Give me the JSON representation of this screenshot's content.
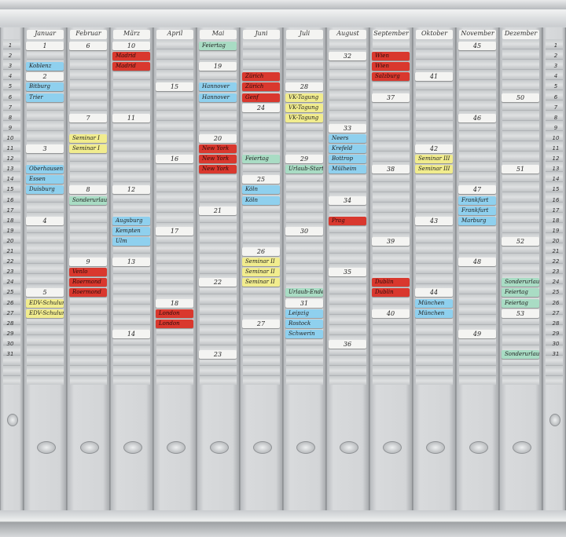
{
  "palette": {
    "white": "#f4f4f2",
    "blue": "#8fd0ee",
    "red": "#d9382e",
    "yellow": "#f1ec8e",
    "green": "#a9dcc4"
  },
  "months": [
    "Januar",
    "Februar",
    "März",
    "April",
    "Mai",
    "Juni",
    "Juli",
    "August",
    "September",
    "Oktober",
    "November",
    "Dezember"
  ],
  "days": [
    "1",
    "2",
    "3",
    "4",
    "5",
    "6",
    "7",
    "8",
    "9",
    "10",
    "11",
    "12",
    "13",
    "14",
    "15",
    "16",
    "17",
    "18",
    "19",
    "20",
    "21",
    "22",
    "23",
    "24",
    "25",
    "26",
    "27",
    "28",
    "29",
    "30",
    "31"
  ],
  "cards": [
    {
      "m": 0,
      "d": 1,
      "t": "1",
      "c": "white"
    },
    {
      "m": 0,
      "d": 3,
      "t": "Koblenz",
      "c": "blue"
    },
    {
      "m": 0,
      "d": 4,
      "t": "2",
      "c": "white"
    },
    {
      "m": 0,
      "d": 5,
      "t": "Bitburg",
      "c": "blue"
    },
    {
      "m": 0,
      "d": 6,
      "t": "Trier",
      "c": "blue"
    },
    {
      "m": 0,
      "d": 11,
      "t": "3",
      "c": "white"
    },
    {
      "m": 0,
      "d": 13,
      "t": "Oberhausen",
      "c": "blue"
    },
    {
      "m": 0,
      "d": 14,
      "t": "Essen",
      "c": "blue"
    },
    {
      "m": 0,
      "d": 15,
      "t": "Duisburg",
      "c": "blue"
    },
    {
      "m": 0,
      "d": 18,
      "t": "4",
      "c": "white"
    },
    {
      "m": 0,
      "d": 25,
      "t": "5",
      "c": "white"
    },
    {
      "m": 0,
      "d": 26,
      "t": "EDV-Schulung",
      "c": "yellow"
    },
    {
      "m": 0,
      "d": 27,
      "t": "EDV-Schulung",
      "c": "yellow"
    },
    {
      "m": 1,
      "d": 1,
      "t": "6",
      "c": "white"
    },
    {
      "m": 1,
      "d": 8,
      "t": "7",
      "c": "white"
    },
    {
      "m": 1,
      "d": 10,
      "t": "Seminar I",
      "c": "yellow"
    },
    {
      "m": 1,
      "d": 11,
      "t": "Seminar I",
      "c": "yellow"
    },
    {
      "m": 1,
      "d": 15,
      "t": "8",
      "c": "white"
    },
    {
      "m": 1,
      "d": 16,
      "t": "Sonderurlaub",
      "c": "green"
    },
    {
      "m": 1,
      "d": 22,
      "t": "9",
      "c": "white"
    },
    {
      "m": 1,
      "d": 23,
      "t": "Venlo",
      "c": "red"
    },
    {
      "m": 1,
      "d": 24,
      "t": "Roermond",
      "c": "red"
    },
    {
      "m": 1,
      "d": 25,
      "t": "Roermond",
      "c": "red"
    },
    {
      "m": 2,
      "d": 1,
      "t": "10",
      "c": "white"
    },
    {
      "m": 2,
      "d": 2,
      "t": "Madrid",
      "c": "red"
    },
    {
      "m": 2,
      "d": 3,
      "t": "Madrid",
      "c": "red"
    },
    {
      "m": 2,
      "d": 8,
      "t": "11",
      "c": "white"
    },
    {
      "m": 2,
      "d": 15,
      "t": "12",
      "c": "white"
    },
    {
      "m": 2,
      "d": 18,
      "t": "Augsburg",
      "c": "blue"
    },
    {
      "m": 2,
      "d": 19,
      "t": "Kempten",
      "c": "blue"
    },
    {
      "m": 2,
      "d": 20,
      "t": "Ulm",
      "c": "blue"
    },
    {
      "m": 2,
      "d": 22,
      "t": "13",
      "c": "white"
    },
    {
      "m": 2,
      "d": 29,
      "t": "14",
      "c": "white"
    },
    {
      "m": 3,
      "d": 5,
      "t": "15",
      "c": "white"
    },
    {
      "m": 3,
      "d": 12,
      "t": "16",
      "c": "white"
    },
    {
      "m": 3,
      "d": 19,
      "t": "17",
      "c": "white"
    },
    {
      "m": 3,
      "d": 26,
      "t": "18",
      "c": "white"
    },
    {
      "m": 3,
      "d": 27,
      "t": "London",
      "c": "red"
    },
    {
      "m": 3,
      "d": 28,
      "t": "London",
      "c": "red"
    },
    {
      "m": 4,
      "d": 1,
      "t": "Feiertag",
      "c": "green"
    },
    {
      "m": 4,
      "d": 3,
      "t": "19",
      "c": "white"
    },
    {
      "m": 4,
      "d": 5,
      "t": "Hannover",
      "c": "blue"
    },
    {
      "m": 4,
      "d": 6,
      "t": "Hannover",
      "c": "blue"
    },
    {
      "m": 4,
      "d": 10,
      "t": "20",
      "c": "white"
    },
    {
      "m": 4,
      "d": 11,
      "t": "New York",
      "c": "red"
    },
    {
      "m": 4,
      "d": 12,
      "t": "New York",
      "c": "red"
    },
    {
      "m": 4,
      "d": 13,
      "t": "New York",
      "c": "red"
    },
    {
      "m": 4,
      "d": 17,
      "t": "21",
      "c": "white"
    },
    {
      "m": 4,
      "d": 24,
      "t": "22",
      "c": "white"
    },
    {
      "m": 4,
      "d": 31,
      "t": "23",
      "c": "white"
    },
    {
      "m": 5,
      "d": 4,
      "t": "Zürich",
      "c": "red"
    },
    {
      "m": 5,
      "d": 5,
      "t": "Zürich",
      "c": "red"
    },
    {
      "m": 5,
      "d": 6,
      "t": "Genf",
      "c": "red"
    },
    {
      "m": 5,
      "d": 7,
      "t": "24",
      "c": "white"
    },
    {
      "m": 5,
      "d": 12,
      "t": "Feiertag",
      "c": "green"
    },
    {
      "m": 5,
      "d": 14,
      "t": "25",
      "c": "white"
    },
    {
      "m": 5,
      "d": 15,
      "t": "Köln",
      "c": "blue"
    },
    {
      "m": 5,
      "d": 16,
      "t": "Köln",
      "c": "blue"
    },
    {
      "m": 5,
      "d": 21,
      "t": "26",
      "c": "white"
    },
    {
      "m": 5,
      "d": 22,
      "t": "Seminar II",
      "c": "yellow"
    },
    {
      "m": 5,
      "d": 23,
      "t": "Seminar II",
      "c": "yellow"
    },
    {
      "m": 5,
      "d": 24,
      "t": "Seminar II",
      "c": "yellow"
    },
    {
      "m": 5,
      "d": 28,
      "t": "27",
      "c": "white"
    },
    {
      "m": 6,
      "d": 5,
      "t": "28",
      "c": "white"
    },
    {
      "m": 6,
      "d": 6,
      "t": "VK-Tagung",
      "c": "yellow"
    },
    {
      "m": 6,
      "d": 7,
      "t": "VK-Tagung",
      "c": "yellow"
    },
    {
      "m": 6,
      "d": 8,
      "t": "VK-Tagung",
      "c": "yellow"
    },
    {
      "m": 6,
      "d": 12,
      "t": "29",
      "c": "white"
    },
    {
      "m": 6,
      "d": 13,
      "t": "Urlaub-Start",
      "c": "green"
    },
    {
      "m": 6,
      "d": 19,
      "t": "30",
      "c": "white"
    },
    {
      "m": 6,
      "d": 25,
      "t": "Urlaub-Ende",
      "c": "green"
    },
    {
      "m": 6,
      "d": 26,
      "t": "31",
      "c": "white"
    },
    {
      "m": 6,
      "d": 27,
      "t": "Leipzig",
      "c": "blue"
    },
    {
      "m": 6,
      "d": 28,
      "t": "Rostock",
      "c": "blue"
    },
    {
      "m": 6,
      "d": 29,
      "t": "Schwerin",
      "c": "blue"
    },
    {
      "m": 7,
      "d": 2,
      "t": "32",
      "c": "white"
    },
    {
      "m": 7,
      "d": 9,
      "t": "33",
      "c": "white"
    },
    {
      "m": 7,
      "d": 10,
      "t": "Neers",
      "c": "blue"
    },
    {
      "m": 7,
      "d": 11,
      "t": "Krefeld",
      "c": "blue"
    },
    {
      "m": 7,
      "d": 12,
      "t": "Bottrop",
      "c": "blue"
    },
    {
      "m": 7,
      "d": 13,
      "t": "Mülheim",
      "c": "blue"
    },
    {
      "m": 7,
      "d": 16,
      "t": "34",
      "c": "white"
    },
    {
      "m": 7,
      "d": 18,
      "t": "Prag",
      "c": "red"
    },
    {
      "m": 7,
      "d": 23,
      "t": "35",
      "c": "white"
    },
    {
      "m": 7,
      "d": 30,
      "t": "36",
      "c": "white"
    },
    {
      "m": 8,
      "d": 2,
      "t": "Wien",
      "c": "red"
    },
    {
      "m": 8,
      "d": 3,
      "t": "Wien",
      "c": "red"
    },
    {
      "m": 8,
      "d": 4,
      "t": "Salzburg",
      "c": "red"
    },
    {
      "m": 8,
      "d": 6,
      "t": "37",
      "c": "white"
    },
    {
      "m": 8,
      "d": 13,
      "t": "38",
      "c": "white"
    },
    {
      "m": 8,
      "d": 20,
      "t": "39",
      "c": "white"
    },
    {
      "m": 8,
      "d": 24,
      "t": "Dublin",
      "c": "red"
    },
    {
      "m": 8,
      "d": 25,
      "t": "Dublin",
      "c": "red"
    },
    {
      "m": 8,
      "d": 27,
      "t": "40",
      "c": "white"
    },
    {
      "m": 9,
      "d": 4,
      "t": "41",
      "c": "white"
    },
    {
      "m": 9,
      "d": 11,
      "t": "42",
      "c": "white"
    },
    {
      "m": 9,
      "d": 12,
      "t": "Seminar III",
      "c": "yellow"
    },
    {
      "m": 9,
      "d": 13,
      "t": "Seminar III",
      "c": "yellow"
    },
    {
      "m": 9,
      "d": 18,
      "t": "43",
      "c": "white"
    },
    {
      "m": 9,
      "d": 25,
      "t": "44",
      "c": "white"
    },
    {
      "m": 9,
      "d": 26,
      "t": "München",
      "c": "blue"
    },
    {
      "m": 9,
      "d": 27,
      "t": "München",
      "c": "blue"
    },
    {
      "m": 10,
      "d": 1,
      "t": "45",
      "c": "white"
    },
    {
      "m": 10,
      "d": 8,
      "t": "46",
      "c": "white"
    },
    {
      "m": 10,
      "d": 15,
      "t": "47",
      "c": "white"
    },
    {
      "m": 10,
      "d": 16,
      "t": "Frankfurt",
      "c": "blue"
    },
    {
      "m": 10,
      "d": 17,
      "t": "Frankfurt",
      "c": "blue"
    },
    {
      "m": 10,
      "d": 18,
      "t": "Marburg",
      "c": "blue"
    },
    {
      "m": 10,
      "d": 22,
      "t": "48",
      "c": "white"
    },
    {
      "m": 10,
      "d": 29,
      "t": "49",
      "c": "white"
    },
    {
      "m": 11,
      "d": 6,
      "t": "50",
      "c": "white"
    },
    {
      "m": 11,
      "d": 13,
      "t": "51",
      "c": "white"
    },
    {
      "m": 11,
      "d": 20,
      "t": "52",
      "c": "white"
    },
    {
      "m": 11,
      "d": 24,
      "t": "Sonderurlaub",
      "c": "green"
    },
    {
      "m": 11,
      "d": 25,
      "t": "Feiertag",
      "c": "green"
    },
    {
      "m": 11,
      "d": 26,
      "t": "Feiertag",
      "c": "green"
    },
    {
      "m": 11,
      "d": 27,
      "t": "53",
      "c": "white"
    },
    {
      "m": 11,
      "d": 31,
      "t": "Sonderurlaub",
      "c": "green"
    }
  ]
}
